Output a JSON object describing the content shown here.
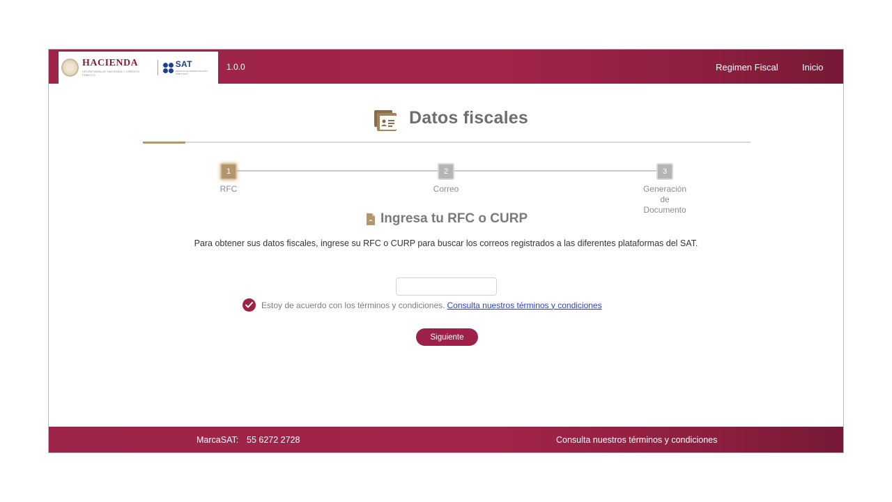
{
  "header": {
    "brand_hacienda": "HACIENDA",
    "brand_hacienda_sub": "SECRETARÍA DE HACIENDA Y CRÉDITO PÚBLICO",
    "brand_sat": "SAT",
    "brand_sat_sub": "SERVICIO DE ADMINISTRACIÓN TRIBUTARIA",
    "version": "1.0.0",
    "nav": [
      {
        "label": "Regimen Fiscal"
      },
      {
        "label": "Inicio"
      }
    ]
  },
  "page": {
    "title": "Datos fiscales",
    "title_icon": "id-card-icon"
  },
  "stepper": {
    "steps": [
      {
        "number": "1",
        "label": "RFC",
        "active": true
      },
      {
        "number": "2",
        "label": "Correo",
        "active": false
      },
      {
        "number": "3",
        "label_lines": [
          "Generación",
          "de",
          "Documento"
        ],
        "active": false
      }
    ]
  },
  "form": {
    "heading": "Ingresa tu RFC o CURP",
    "heading_icon": "document-icon",
    "instructions": "Para obtener sus datos fiscales, ingrese su RFC o CURP para buscar los correos registrados a las diferentes plataformas del SAT.",
    "rfc_value": "",
    "agree_checked": true,
    "agree_text": "Estoy de acuerdo con los términos y condiciones.",
    "agree_link": "Consulta nuestros términos y condiciones",
    "next_label": "Siguiente"
  },
  "footer": {
    "marca_label": "MarcaSAT:",
    "phone": "55 6272 2728",
    "terms_link": "Consulta nuestros términos y condiciones"
  },
  "colors": {
    "brand": "#9d2148",
    "accent_gold": "#bc955c",
    "link": "#2b3fd1"
  }
}
